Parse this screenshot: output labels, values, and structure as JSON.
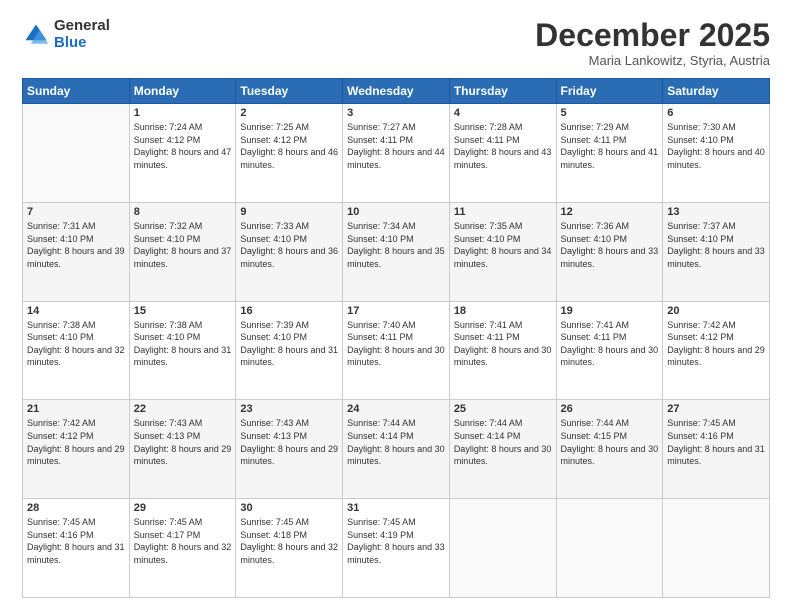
{
  "logo": {
    "general": "General",
    "blue": "Blue"
  },
  "header": {
    "month": "December 2025",
    "location": "Maria Lankowitz, Styria, Austria"
  },
  "weekdays": [
    "Sunday",
    "Monday",
    "Tuesday",
    "Wednesday",
    "Thursday",
    "Friday",
    "Saturday"
  ],
  "weeks": [
    [
      {
        "day": "",
        "sunrise": "",
        "sunset": "",
        "daylight": ""
      },
      {
        "day": "1",
        "sunrise": "Sunrise: 7:24 AM",
        "sunset": "Sunset: 4:12 PM",
        "daylight": "Daylight: 8 hours and 47 minutes."
      },
      {
        "day": "2",
        "sunrise": "Sunrise: 7:25 AM",
        "sunset": "Sunset: 4:12 PM",
        "daylight": "Daylight: 8 hours and 46 minutes."
      },
      {
        "day": "3",
        "sunrise": "Sunrise: 7:27 AM",
        "sunset": "Sunset: 4:11 PM",
        "daylight": "Daylight: 8 hours and 44 minutes."
      },
      {
        "day": "4",
        "sunrise": "Sunrise: 7:28 AM",
        "sunset": "Sunset: 4:11 PM",
        "daylight": "Daylight: 8 hours and 43 minutes."
      },
      {
        "day": "5",
        "sunrise": "Sunrise: 7:29 AM",
        "sunset": "Sunset: 4:11 PM",
        "daylight": "Daylight: 8 hours and 41 minutes."
      },
      {
        "day": "6",
        "sunrise": "Sunrise: 7:30 AM",
        "sunset": "Sunset: 4:10 PM",
        "daylight": "Daylight: 8 hours and 40 minutes."
      }
    ],
    [
      {
        "day": "7",
        "sunrise": "Sunrise: 7:31 AM",
        "sunset": "Sunset: 4:10 PM",
        "daylight": "Daylight: 8 hours and 39 minutes."
      },
      {
        "day": "8",
        "sunrise": "Sunrise: 7:32 AM",
        "sunset": "Sunset: 4:10 PM",
        "daylight": "Daylight: 8 hours and 37 minutes."
      },
      {
        "day": "9",
        "sunrise": "Sunrise: 7:33 AM",
        "sunset": "Sunset: 4:10 PM",
        "daylight": "Daylight: 8 hours and 36 minutes."
      },
      {
        "day": "10",
        "sunrise": "Sunrise: 7:34 AM",
        "sunset": "Sunset: 4:10 PM",
        "daylight": "Daylight: 8 hours and 35 minutes."
      },
      {
        "day": "11",
        "sunrise": "Sunrise: 7:35 AM",
        "sunset": "Sunset: 4:10 PM",
        "daylight": "Daylight: 8 hours and 34 minutes."
      },
      {
        "day": "12",
        "sunrise": "Sunrise: 7:36 AM",
        "sunset": "Sunset: 4:10 PM",
        "daylight": "Daylight: 8 hours and 33 minutes."
      },
      {
        "day": "13",
        "sunrise": "Sunrise: 7:37 AM",
        "sunset": "Sunset: 4:10 PM",
        "daylight": "Daylight: 8 hours and 33 minutes."
      }
    ],
    [
      {
        "day": "14",
        "sunrise": "Sunrise: 7:38 AM",
        "sunset": "Sunset: 4:10 PM",
        "daylight": "Daylight: 8 hours and 32 minutes."
      },
      {
        "day": "15",
        "sunrise": "Sunrise: 7:38 AM",
        "sunset": "Sunset: 4:10 PM",
        "daylight": "Daylight: 8 hours and 31 minutes."
      },
      {
        "day": "16",
        "sunrise": "Sunrise: 7:39 AM",
        "sunset": "Sunset: 4:10 PM",
        "daylight": "Daylight: 8 hours and 31 minutes."
      },
      {
        "day": "17",
        "sunrise": "Sunrise: 7:40 AM",
        "sunset": "Sunset: 4:11 PM",
        "daylight": "Daylight: 8 hours and 30 minutes."
      },
      {
        "day": "18",
        "sunrise": "Sunrise: 7:41 AM",
        "sunset": "Sunset: 4:11 PM",
        "daylight": "Daylight: 8 hours and 30 minutes."
      },
      {
        "day": "19",
        "sunrise": "Sunrise: 7:41 AM",
        "sunset": "Sunset: 4:11 PM",
        "daylight": "Daylight: 8 hours and 30 minutes."
      },
      {
        "day": "20",
        "sunrise": "Sunrise: 7:42 AM",
        "sunset": "Sunset: 4:12 PM",
        "daylight": "Daylight: 8 hours and 29 minutes."
      }
    ],
    [
      {
        "day": "21",
        "sunrise": "Sunrise: 7:42 AM",
        "sunset": "Sunset: 4:12 PM",
        "daylight": "Daylight: 8 hours and 29 minutes."
      },
      {
        "day": "22",
        "sunrise": "Sunrise: 7:43 AM",
        "sunset": "Sunset: 4:13 PM",
        "daylight": "Daylight: 8 hours and 29 minutes."
      },
      {
        "day": "23",
        "sunrise": "Sunrise: 7:43 AM",
        "sunset": "Sunset: 4:13 PM",
        "daylight": "Daylight: 8 hours and 29 minutes."
      },
      {
        "day": "24",
        "sunrise": "Sunrise: 7:44 AM",
        "sunset": "Sunset: 4:14 PM",
        "daylight": "Daylight: 8 hours and 30 minutes."
      },
      {
        "day": "25",
        "sunrise": "Sunrise: 7:44 AM",
        "sunset": "Sunset: 4:14 PM",
        "daylight": "Daylight: 8 hours and 30 minutes."
      },
      {
        "day": "26",
        "sunrise": "Sunrise: 7:44 AM",
        "sunset": "Sunset: 4:15 PM",
        "daylight": "Daylight: 8 hours and 30 minutes."
      },
      {
        "day": "27",
        "sunrise": "Sunrise: 7:45 AM",
        "sunset": "Sunset: 4:16 PM",
        "daylight": "Daylight: 8 hours and 31 minutes."
      }
    ],
    [
      {
        "day": "28",
        "sunrise": "Sunrise: 7:45 AM",
        "sunset": "Sunset: 4:16 PM",
        "daylight": "Daylight: 8 hours and 31 minutes."
      },
      {
        "day": "29",
        "sunrise": "Sunrise: 7:45 AM",
        "sunset": "Sunset: 4:17 PM",
        "daylight": "Daylight: 8 hours and 32 minutes."
      },
      {
        "day": "30",
        "sunrise": "Sunrise: 7:45 AM",
        "sunset": "Sunset: 4:18 PM",
        "daylight": "Daylight: 8 hours and 32 minutes."
      },
      {
        "day": "31",
        "sunrise": "Sunrise: 7:45 AM",
        "sunset": "Sunset: 4:19 PM",
        "daylight": "Daylight: 8 hours and 33 minutes."
      },
      {
        "day": "",
        "sunrise": "",
        "sunset": "",
        "daylight": ""
      },
      {
        "day": "",
        "sunrise": "",
        "sunset": "",
        "daylight": ""
      },
      {
        "day": "",
        "sunrise": "",
        "sunset": "",
        "daylight": ""
      }
    ]
  ]
}
